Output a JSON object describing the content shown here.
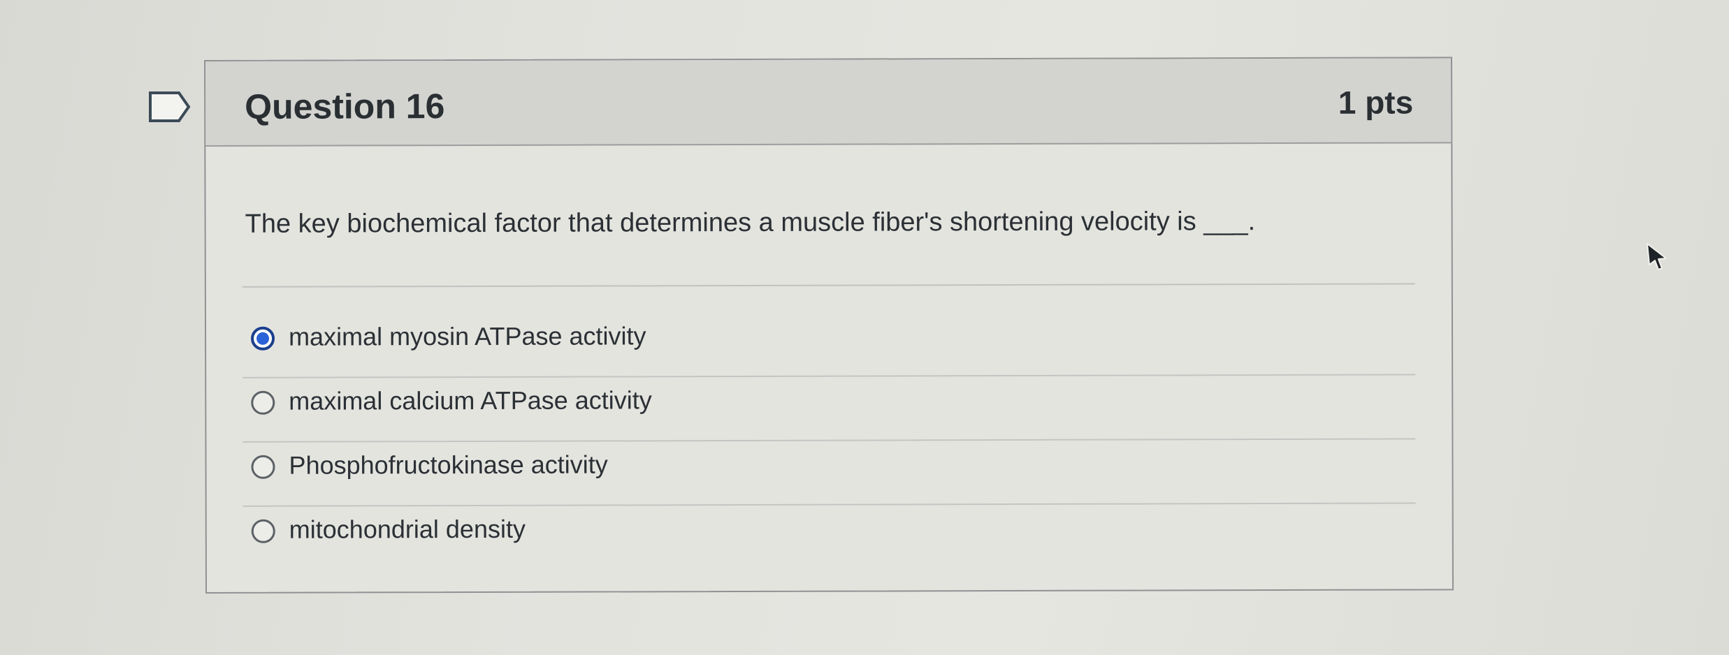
{
  "question": {
    "title": "Question 16",
    "points": "1 pts",
    "text": "The key biochemical factor that determines a muscle fiber's shortening velocity is ___.",
    "answers": [
      {
        "label": "maximal myosin ATPase activity",
        "selected": true
      },
      {
        "label": "maximal calcium ATPase activity",
        "selected": false
      },
      {
        "label": "Phosphofructokinase activity",
        "selected": false
      },
      {
        "label": "mitochondrial density",
        "selected": false
      }
    ]
  },
  "icons": {
    "flag": "flag-icon",
    "cursor": "cursor-icon"
  },
  "colors": {
    "selected_radio": "#2c62d8",
    "header_background": "#d3d4d0"
  }
}
